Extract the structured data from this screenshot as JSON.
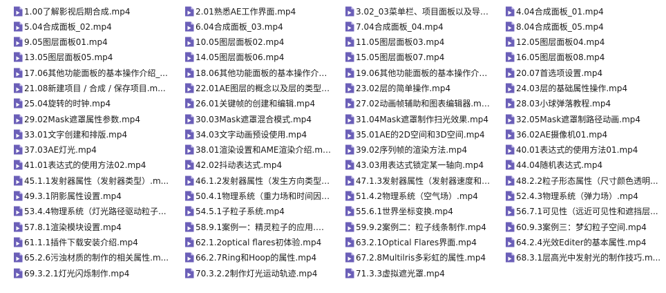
{
  "colors": {
    "icon_bg": "#6b5fb8",
    "icon_fold": "#c9c3ee",
    "text": "#1a1a1a",
    "background": "#ffffff"
  },
  "file_icon": "video-file-icon",
  "files": [
    "1.00了解影视后期合成.mp4",
    "5.04合成面板_02.mp4",
    "9.05图层面板01.mp4",
    "13.05图层面板05.mp4",
    "17.06其他功能面板的基本操作介绍_...",
    "21.08新建项目 / 合成 / 保存项目.m...",
    "25.04旋转的时钟.mp4",
    "29.02Mask遮罩属性参数.mp4",
    "33.01文字创建和排版.mp4",
    "37.03AE灯光.mp4",
    "41.01表达式的使用方法02.mp4",
    "45.1.1发射器属性（发射器类型）.m...",
    "49.3.1阴影属性设置.mp4",
    "53.4.4物理系统（灯光路径驱动粒子...",
    "57.8.1渲染模块设置.mp4",
    "61.1.1插件下载安装介绍.mp4",
    "65.2.6污浊材质的制作的相关属性.m...",
    "69.3.2.1灯光闪烁制作.mp4",
    "2.01熟悉AE工作界面.mp4",
    "6.04合成面板_03.mp4",
    "10.05图层面板02.mp4",
    "14.05图层面板06.mp4",
    "18.06其他功能面板的基本操作介绍_...",
    "22.01AE图层的概念以及层的类型.m...",
    "26.01关键帧的创建和编辑.mp4",
    "30.03Mask遮罩混合模式.mp4",
    "34.03文字动画预设使用.mp4",
    "38.01渲染设置和AME渲染介绍.mp4",
    "42.02抖动表达式.mp4",
    "46.1.2发射器属性（发生方向类型）...",
    "50.4.1物理系统（重力场和时间因数...",
    "54.5.1子粒子系统.mp4",
    "58.9.1案例一：精灵粒子的应用.mp4",
    "62.1.2optical flares初体验.mp4",
    "66.2.7Ring和Hoop的属性.mp4",
    "70.3.2.2制作灯光运动轨迹.mp4",
    "3.02_03菜单栏、项目面板以及导入...",
    "7.04合成面板_04.mp4",
    "11.05图层面板03.mp4",
    "15.05图层面板07.mp4",
    "19.06其他功能面板的基本操作介绍...",
    "23.02层的简单操作.mp4",
    "27.02动画帧辅助和图表编辑器.mp4",
    "31.04Mask遮罩制作扫光效果.mp4",
    "35.01AE的2D空间和3D空间.mp4",
    "39.02序列帧的渲染方法.mp4",
    "43.03用表达式锁定某一轴向.mp4",
    "47.1.3发射器属性（发射器速度和随...",
    "51.4.2物理系统（空气场）.mp4",
    "55.6.1世界坐标变换.mp4",
    "59.9.2案例二：粒子线条制作.mp4",
    "63.2.1Optical Flares界面.mp4",
    "67.2.8Multilris多彩虹的属性.mp4",
    "71.3.3虚拟遮光罩.mp4",
    "4.04合成面板_01.mp4",
    "8.04合成面板_05.mp4",
    "12.05图层面板04.mp4",
    "16.05图层面板08.mp4",
    "20.07首选项设置.mp4",
    "24.03层的基础属性操作.mp4",
    "28.03小球弹落教程.mp4",
    "32.05Mask遮罩制路径动画.mp4",
    "36.02AE摄像机01.mp4",
    "40.01表达式的使用方法01.mp4",
    "44.04随机表达式.mp4",
    "48.2.2粒子形态属性（尺寸颜色透明...",
    "52.4.3物理系统（弹力场）.mp4",
    "56.7.1可见性（远近可见性和遮挡层...",
    "60.9.3案例三：梦幻粒子空间.mp4",
    "64.2.4光效Editer的基本属性.mp4",
    "68.3.1层高光中发射光的制作技巧.m...",
    ""
  ]
}
